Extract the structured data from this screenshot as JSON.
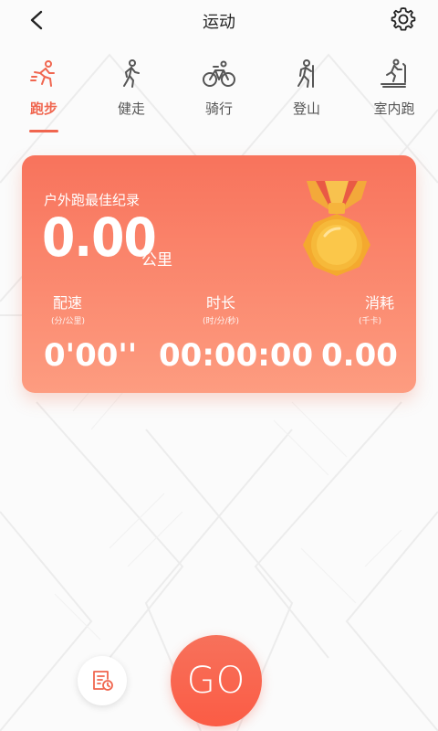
{
  "header": {
    "title": "运动"
  },
  "tabs": [
    {
      "label": "跑步",
      "icon": "running-icon",
      "active": true
    },
    {
      "label": "健走",
      "icon": "walking-icon",
      "active": false
    },
    {
      "label": "骑行",
      "icon": "cycling-icon",
      "active": false
    },
    {
      "label": "登山",
      "icon": "hiking-icon",
      "active": false
    },
    {
      "label": "室内跑",
      "icon": "treadmill-icon",
      "active": false
    }
  ],
  "record": {
    "title": "户外跑最佳纪录",
    "distance": "0.00",
    "unit": "公里",
    "pace": {
      "label": "配速",
      "sub": "(分/公里)",
      "value": "0'00''"
    },
    "duration": {
      "label": "时长",
      "sub": "(时/分/秒)",
      "value": "00:00:00"
    },
    "calories": {
      "label": "消耗",
      "sub": "(千卡)",
      "value": "0.00"
    }
  },
  "actions": {
    "go_label": "GO"
  },
  "colors": {
    "accent": "#f0664f",
    "card_top": "#f8735c",
    "card_bottom": "#fd9c80"
  }
}
